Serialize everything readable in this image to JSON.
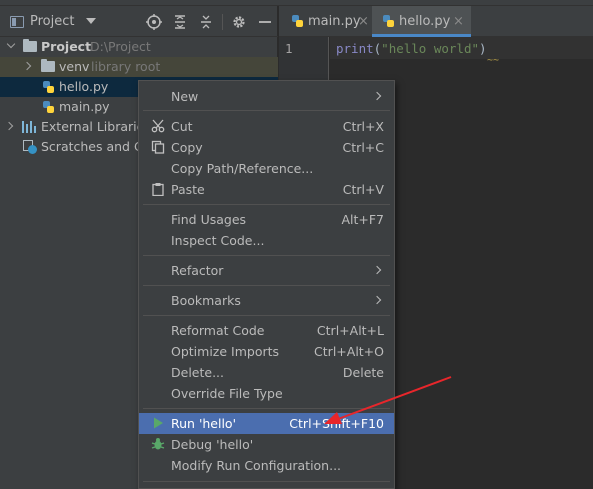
{
  "project_panel": {
    "title": "Project",
    "title_icon": "project-panel-icon",
    "header_icons": [
      "locate-icon",
      "expand-all-icon",
      "collapse-all-icon",
      "gear-icon",
      "hide-icon"
    ],
    "tree": {
      "root": {
        "label": "Project",
        "path": "D:\\Project"
      },
      "venv": {
        "label": "venv",
        "hint": "library root"
      },
      "hello": {
        "label": "hello.py"
      },
      "main": {
        "label": "main.py"
      },
      "external": {
        "label": "External Libraries"
      },
      "scratches": {
        "label": "Scratches and Co"
      }
    }
  },
  "editor": {
    "tabs": [
      {
        "label": "main.py",
        "close": "×"
      },
      {
        "label": "hello.py",
        "close": "×",
        "active": true
      }
    ],
    "line_number": "1",
    "code": {
      "fn": "print",
      "open": "(",
      "str": "\"hello world\"",
      "close": ")"
    },
    "squiggle": "~~"
  },
  "context_menu": {
    "new": "New",
    "cut": {
      "label": "Cut",
      "shortcut": "Ctrl+X"
    },
    "copy": {
      "label": "Copy",
      "shortcut": "Ctrl+C"
    },
    "copy_path": {
      "label": "Copy Path/Reference..."
    },
    "paste": {
      "label": "Paste",
      "shortcut": "Ctrl+V"
    },
    "find_usages": {
      "label": "Find Usages",
      "shortcut": "Alt+F7"
    },
    "inspect_code": {
      "label": "Inspect Code..."
    },
    "refactor": {
      "label": "Refactor"
    },
    "bookmarks": {
      "label": "Bookmarks"
    },
    "reformat": {
      "label": "Reformat Code",
      "shortcut": "Ctrl+Alt+L"
    },
    "optimize": {
      "label": "Optimize Imports",
      "shortcut": "Ctrl+Alt+O"
    },
    "delete": {
      "label": "Delete...",
      "shortcut": "Delete"
    },
    "override": {
      "label": "Override File Type"
    },
    "run": {
      "label": "Run 'hello'",
      "shortcut": "Ctrl+Shift+F10"
    },
    "debug": {
      "label": "Debug 'hello'"
    },
    "modify_run": {
      "label": "Modify Run Configuration..."
    }
  },
  "colors": {
    "background": "#2b2b2b",
    "panel": "#3c3f41",
    "selection": "#4b6eaf",
    "annotation_arrow": "#e8262b"
  }
}
